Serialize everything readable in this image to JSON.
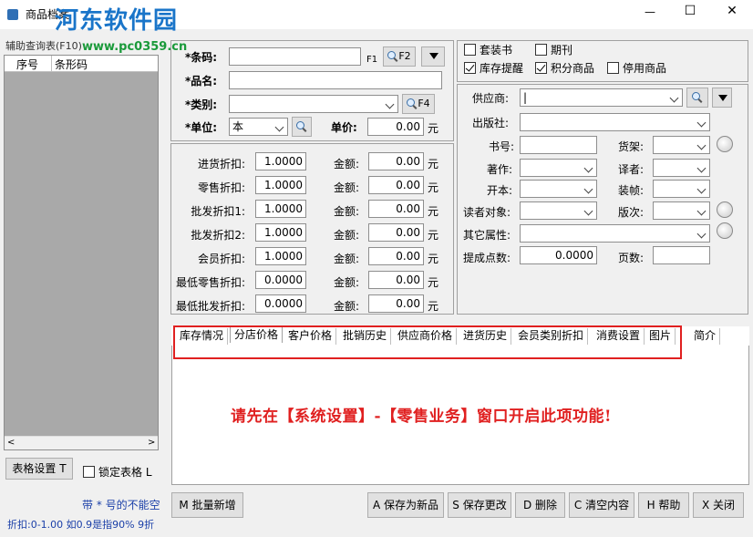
{
  "window": {
    "title": "商品档案",
    "watermark_title": "河东软件园",
    "watermark_url": "www.pc0359.cn",
    "minimize": "—",
    "maximize": "☐",
    "close": "✕"
  },
  "left_panel": {
    "title": "辅助查询表(F10)",
    "columns": [
      "序号",
      "条形码"
    ],
    "table_settings_btn": "表格设置 T",
    "lock_table_label": "锁定表格 L",
    "note_required": "带 * 号的不能空",
    "note_discount": "折扣:0-1.00 如0.9是指90% 9折"
  },
  "basic": {
    "barcode_label": "*条码:",
    "barcode_value": "",
    "f1_label": "F1",
    "f2_btn": "F2",
    "name_label": "*品名:",
    "name_value": "",
    "category_label": "*类别:",
    "category_value": "",
    "f4_btn": "F4",
    "unit_label": "*单位:",
    "unit_value": "本",
    "price_label": "单价:",
    "price_value": "0.00",
    "yuan": "元"
  },
  "discounts": [
    {
      "label": "进货折扣:",
      "rate": "1.0000",
      "amount_label": "金额:",
      "amount": "0.00",
      "unit": "元"
    },
    {
      "label": "零售折扣:",
      "rate": "1.0000",
      "amount_label": "金额:",
      "amount": "0.00",
      "unit": "元"
    },
    {
      "label": "批发折扣1:",
      "rate": "1.0000",
      "amount_label": "金额:",
      "amount": "0.00",
      "unit": "元"
    },
    {
      "label": "批发折扣2:",
      "rate": "1.0000",
      "amount_label": "金额:",
      "amount": "0.00",
      "unit": "元"
    },
    {
      "label": "会员折扣:",
      "rate": "1.0000",
      "amount_label": "金额:",
      "amount": "0.00",
      "unit": "元"
    },
    {
      "label": "最低零售折扣:",
      "rate": "0.0000",
      "amount_label": "金额:",
      "amount": "0.00",
      "unit": "元"
    },
    {
      "label": "最低批发折扣:",
      "rate": "0.0000",
      "amount_label": "金额:",
      "amount": "0.00",
      "unit": "元"
    }
  ],
  "flags": {
    "set_book": {
      "label": "套装书",
      "checked": false
    },
    "periodical": {
      "label": "期刊",
      "checked": false
    },
    "stock_alert": {
      "label": "库存提醒",
      "checked": true
    },
    "points_goods": {
      "label": "积分商品",
      "checked": true
    },
    "disabled_goods": {
      "label": "停用商品",
      "checked": false
    }
  },
  "detail": {
    "supplier_label": "供应商:",
    "supplier_value": "|",
    "publisher_label": "出版社:",
    "book_no_label": "书号:",
    "shelf_label": "货架:",
    "author_label": "著作:",
    "translator_label": "译者:",
    "format_label": "开本:",
    "binding_label": "装帧:",
    "readers_label": "读者对象:",
    "edition_label": "版次:",
    "other_label": "其它属性:",
    "commission_label": "提成点数:",
    "commission_value": "0.0000",
    "pages_label": "页数:"
  },
  "tabs": [
    "库存情况",
    "分店价格",
    "客户价格",
    "批销历史",
    "供应商价格",
    "进货历史",
    "会员类别折扣",
    "消费设置",
    "图片",
    "简介"
  ],
  "tab_message": "请先在【系统设置】-【零售业务】窗口开启此项功能!",
  "buttons": {
    "batch_new": "M 批量新增",
    "save_new": "A 保存为新品",
    "save_changes": "S 保存更改",
    "delete": "D 删除",
    "clear": "C 清空内容",
    "help": "H 帮助",
    "close": "X 关闭"
  },
  "colors": {
    "highlight_border": "#e02020",
    "message_red": "#e02020",
    "watermark_blue": "#1a75c9",
    "watermark_green": "#1a9a3a"
  }
}
